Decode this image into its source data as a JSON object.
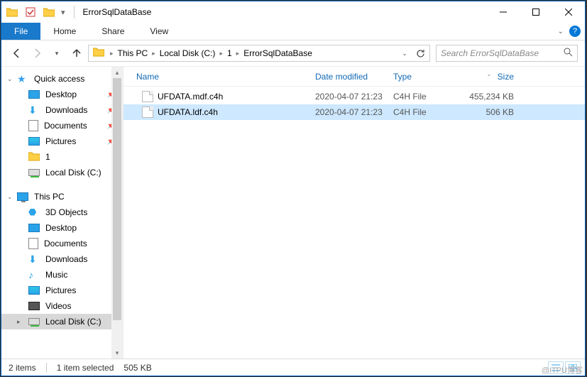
{
  "title": "ErrorSqlDataBase",
  "ribbon": {
    "file": "File",
    "tabs": [
      "Home",
      "Share",
      "View"
    ]
  },
  "breadcrumbs": [
    "This PC",
    "Local Disk (C:)",
    "1",
    "ErrorSqlDataBase"
  ],
  "search_placeholder": "Search ErrorSqlDataBase",
  "sidebar": {
    "quick": {
      "label": "Quick access",
      "items": [
        {
          "label": "Desktop",
          "pinned": true,
          "icon": "desktop"
        },
        {
          "label": "Downloads",
          "pinned": true,
          "icon": "downloads"
        },
        {
          "label": "Documents",
          "pinned": true,
          "icon": "documents"
        },
        {
          "label": "Pictures",
          "pinned": true,
          "icon": "pictures"
        },
        {
          "label": "1",
          "pinned": false,
          "icon": "folder"
        },
        {
          "label": "Local Disk (C:)",
          "pinned": false,
          "icon": "drive"
        }
      ]
    },
    "thispc": {
      "label": "This PC",
      "items": [
        {
          "label": "3D Objects",
          "icon": "obj3d"
        },
        {
          "label": "Desktop",
          "icon": "desktop"
        },
        {
          "label": "Documents",
          "icon": "documents"
        },
        {
          "label": "Downloads",
          "icon": "downloads"
        },
        {
          "label": "Music",
          "icon": "music"
        },
        {
          "label": "Pictures",
          "icon": "pictures"
        },
        {
          "label": "Videos",
          "icon": "videos"
        },
        {
          "label": "Local Disk (C:)",
          "icon": "drive",
          "selected": true
        }
      ]
    }
  },
  "columns": {
    "name": "Name",
    "date": "Date modified",
    "type": "Type",
    "size": "Size"
  },
  "files": [
    {
      "name": "UFDATA.mdf.c4h",
      "date": "2020-04-07 21:23",
      "type": "C4H File",
      "size": "455,234 KB",
      "selected": false
    },
    {
      "name": "UFDATA.ldf.c4h",
      "date": "2020-04-07 21:23",
      "type": "C4H File",
      "size": "506 KB",
      "selected": true
    }
  ],
  "status": {
    "items": "2 items",
    "selected": "1 item selected",
    "size": "505 KB"
  },
  "watermark": "@ITPU博客"
}
